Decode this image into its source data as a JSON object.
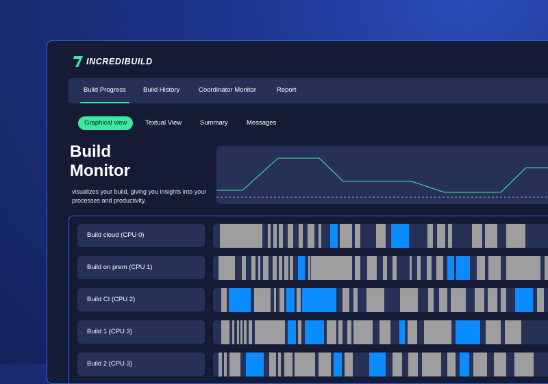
{
  "app": {
    "logo_text": "INCREDIBUILD",
    "accent": "#3ee8a0",
    "border_color": "#3760d8"
  },
  "main_nav": {
    "tabs": [
      {
        "label": "Build Progress",
        "active": true
      },
      {
        "label": "Build History",
        "active": false
      },
      {
        "label": "Coordinator Monitor",
        "active": false
      },
      {
        "label": "Report",
        "active": false
      }
    ]
  },
  "sub_nav": {
    "tabs": [
      {
        "label": "Graphical view",
        "active": true
      },
      {
        "label": "Textual View",
        "active": false
      },
      {
        "label": "Summary",
        "active": false
      },
      {
        "label": "Messages",
        "active": false
      }
    ]
  },
  "hero": {
    "title_line1": "Build",
    "title_line2": "Monitor",
    "description": "visualizes your build, giving you insights into your processes and productivity."
  },
  "activity_chart": {
    "line_color": "#3ee8a0",
    "baseline_style": "dashed"
  },
  "timeline": {
    "colors": {
      "idle": "#9e9e9e",
      "active": "#0a8cff",
      "track": "#273158"
    },
    "rows": [
      {
        "label": "Build cloud (CPU 0)"
      },
      {
        "label": "Build on prem (CPU 1)"
      },
      {
        "label": "Build CI (CPU 2)"
      },
      {
        "label": "Build 1 (CPU 3)"
      },
      {
        "label": "Build 2 (CPU 3)"
      }
    ]
  }
}
